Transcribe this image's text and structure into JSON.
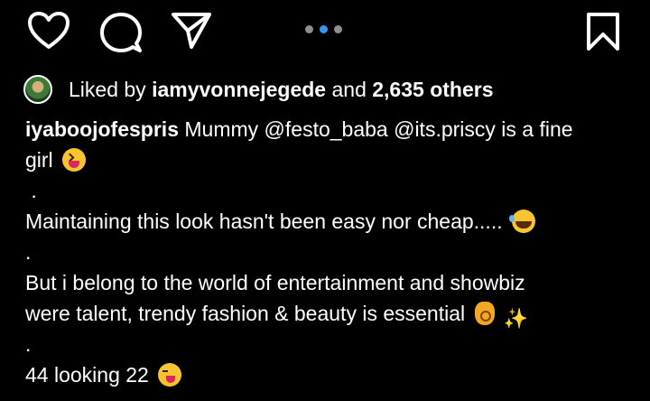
{
  "actions": {
    "like_icon": "heart-outline",
    "comment_icon": "comment-bubble",
    "share_icon": "paper-plane",
    "save_icon": "bookmark-outline"
  },
  "carousel": {
    "count": 3,
    "active_index": 1,
    "active_color": "#3897f0",
    "inactive_color": "#8e8e8e"
  },
  "likes": {
    "prefix": "Liked by",
    "user": "iamyvonnejegede",
    "connector": "and",
    "count_text": "2,635 others"
  },
  "caption": {
    "username": "iyaboojofespris",
    "line1_text": " Mummy @festo_baba @its.priscy is a fine",
    "line2_text": "girl",
    "dot1": ".",
    "line3_text": "Maintaining this look hasn't  been easy nor cheap.....",
    "dot2": ".",
    "line4_text": "But i belong to the world of entertainment and showbiz",
    "line5_text": "were talent,  trendy fashion &  beauty is essential",
    "dot3": ".",
    "line6_text": "44 looking 22",
    "sparkles": "✨"
  },
  "colors": {
    "background": "#000000",
    "text": "#ffffff"
  }
}
